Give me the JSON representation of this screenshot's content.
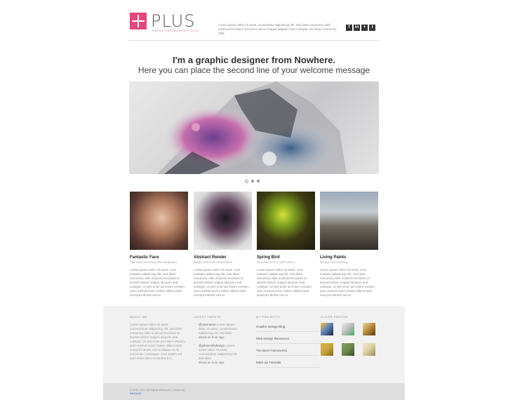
{
  "header": {
    "logo_text": "PLUS",
    "logo_tagline": "SIMPLE DESIGN PORTFOLIO",
    "intro_text": "Lorem ipsum dolor sit amet, consectetur adipiscing elit, sed diam nonummy nibh euismod tincidunt ut laoreet dolore magna aliquam erat volutpat, sed diam nonummy nibh.",
    "social": [
      "f",
      "in",
      "+",
      "t"
    ]
  },
  "welcome": {
    "line1": "I'm a graphic designer from Nowhere.",
    "line2": "Here you can place the second line of your welcome message"
  },
  "slider": {
    "dots": 3,
    "active": 0
  },
  "portfolio": [
    {
      "title": "Fantastic Face",
      "subtitle": "The most amazing face wallpaper",
      "desc": "Lorem ipsum dolor sit amet, cons ectetuer adipiscing elit, sed diam nonummy nibh euismod tincidunt ut laoreet dolore magna aliquam erat volutpat. Ut wisi enim ad minim veniam, quis nostrud exerci tation ullamcorper suscipit lobortis nisl ut."
    },
    {
      "title": "Abstract Render",
      "subtitle": "Bright colourful composition",
      "desc": "Lorem ipsum dolor sit amet, cons ectetuer adipiscing elit, sed diam nonummy nibh euismod tincidunt ut laoreet dolore magna aliquam erat volutpat. Ut wisi enim ad minim veniam, quis nostrud exerci tation ullamcorper suscipit lobortis nisl ut."
    },
    {
      "title": "Spring Bird",
      "subtitle": "Beautiful bird in wild nature",
      "desc": "Lorem ipsum dolor sit amet, cons ectetuer adipiscing elit, sed diam nonummy nibh euismod tincidunt ut laoreet dolore magna aliquam erat volutpat. Ut wisi enim ad minim veniam, quis nostrud exerci tation ullamcorper suscipit lobortis nisl ut."
    },
    {
      "title": "Living Paints",
      "subtitle": "Reality and painting",
      "desc": "Lorem ipsum dolor sit amet, cons ectetuer adipiscing elit, sed diam nonummy nibh euismod tincidunt ut laoreet dolore magna aliquam erat volutpat. Ut wisi enim ad minim veniam, quis nostrud exerci tation ullamcorper suscipit lobortis nisl ut."
    }
  ],
  "footer": {
    "about": {
      "heading": "ABOUT ME",
      "text": "Lorem ipsum dolor sit amet, consectetuer adipiscing elit, sed diam nonummy nibh euismod tincidunt ut laoreet dolore magna aliquam erat volutpat. Ut wisi enim ad minim veniam, quis nostrud exerci tation ullamcorper suscipit lobortis nisl ut aliquip ex ea commodo consequat. Duis autem vel eum iriure dolor in hendrerit in."
    },
    "tweets": {
      "heading": "LATEST TWEETS",
      "items": [
        {
          "user": "@username",
          "text": "Lorem ipsum dolor sit amet, consectetuer adipiscing elit, sed diam",
          "when": "about an hour ago"
        },
        {
          "user": "@johnsmithdesign",
          "text": "Lorem ipsum dolor sit amet, consectetuer adipiscing elit, sed diam",
          "when": "about an hour ago"
        }
      ]
    },
    "projects": {
      "heading": "MY PROJECTS",
      "items": [
        "Graphic Design Blog",
        "Web Design Resources",
        "The Best Frameworks",
        "Mark Up Tutorials"
      ]
    },
    "flickr": {
      "heading": "FLICKR PHOTOS",
      "photos": [
        "#5a7fb8",
        "#cfcfcf",
        "#b88a3a",
        "#c9a43c",
        "#6a8a4a",
        "#d8cfa0"
      ]
    },
    "copyright": "© 2011-2012 All Rights Reserved. Coded by",
    "credit": "BROKSE"
  },
  "colors": {
    "accent": "#e8457a"
  }
}
